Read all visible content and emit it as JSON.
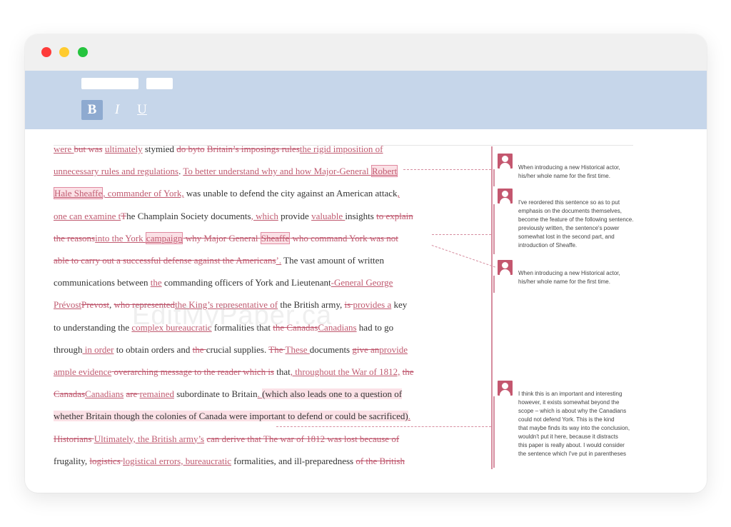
{
  "window": {
    "controls": [
      "close",
      "minimize",
      "maximize"
    ]
  },
  "toolbar": {
    "bold": "B",
    "italic": "I",
    "underline": "U"
  },
  "watermark": "EditMyPaper.ca",
  "document": {
    "lines": [
      [
        {
          "t": "were ",
          "s": "ins"
        },
        {
          "t": "but was",
          "s": "del"
        },
        {
          "t": " "
        },
        {
          "t": "ultimately",
          "s": "ins"
        },
        {
          "t": " stymied "
        },
        {
          "t": "do by",
          "s": "del"
        },
        {
          "t": "to",
          "s": "del"
        },
        {
          "t": " "
        },
        {
          "t": "Britain’s imposings rules",
          "s": "del"
        },
        {
          "t": "the rigid imposition of",
          "s": "ins"
        }
      ],
      [
        {
          "t": "unnecessary rules and regulations",
          "s": "ins"
        },
        {
          "t": ".  "
        },
        {
          "t": "To better understand why and how Major-General ",
          "s": "ins"
        },
        {
          "t": "Robert",
          "s": "ins hl box"
        }
      ],
      [
        {
          "t": "Hale Sheaffe",
          "s": "ins hl box"
        },
        {
          "t": ", commander of York,",
          "s": "ins"
        },
        {
          "t": " was unable to defend the city against an American attack"
        },
        {
          "t": ",",
          "s": "ins"
        }
      ],
      [
        {
          "t": "one can examine t",
          "s": "ins"
        },
        {
          "t": "T",
          "s": "del"
        },
        {
          "t": "he Champlain Society documents"
        },
        {
          "t": ", which",
          "s": "ins"
        },
        {
          "t": " provide "
        },
        {
          "t": "valuable ",
          "s": "ins"
        },
        {
          "t": "insights "
        },
        {
          "t": "to explain",
          "s": "del"
        }
      ],
      [
        {
          "t": "the reasons",
          "s": "del"
        },
        {
          "t": "into the York ",
          "s": "ins"
        },
        {
          "t": "campaign",
          "s": "ins hl box"
        },
        {
          "t": " why Major General ",
          "s": "del"
        },
        {
          "t": "Sheaffe",
          "s": "del hl box"
        },
        {
          "t": " who command York was not",
          "s": "del"
        }
      ],
      [
        {
          "t": "able to carry out a successful defense against the Americans",
          "s": "del"
        },
        {
          "t": "’.",
          "s": "ins"
        },
        {
          "t": "  The vast amount of written"
        }
      ],
      [
        {
          "t": "communications between "
        },
        {
          "t": "the",
          "s": "ins"
        },
        {
          "t": " commanding officers of York and Lieutenant"
        },
        {
          "t": "-General George",
          "s": "ins"
        }
      ],
      [
        {
          "t": "Prévost",
          "s": "ins"
        },
        {
          "t": "Prevost",
          "s": "del"
        },
        {
          "t": ", "
        },
        {
          "t": "who represented",
          "s": "del"
        },
        {
          "t": "the King’s representative of",
          "s": "ins"
        },
        {
          "t": " the British army, "
        },
        {
          "t": "is ",
          "s": "del"
        },
        {
          "t": "provides a",
          "s": "ins"
        },
        {
          "t": " key"
        }
      ],
      [
        {
          "t": "to understanding the "
        },
        {
          "t": "complex bureaucratic",
          "s": "ins"
        },
        {
          "t": " formalities that "
        },
        {
          "t": "the Canadas",
          "s": "del"
        },
        {
          "t": "Canadians",
          "s": "ins"
        },
        {
          "t": " had to go"
        }
      ],
      [
        {
          "t": "through"
        },
        {
          "t": " in order",
          "s": "ins"
        },
        {
          "t": " to obtain orders and "
        },
        {
          "t": "the ",
          "s": "del"
        },
        {
          "t": "crucial supplies.  "
        },
        {
          "t": "The ",
          "s": "del"
        },
        {
          "t": "These ",
          "s": "ins"
        },
        {
          "t": "documents "
        },
        {
          "t": "give an",
          "s": "del"
        },
        {
          "t": "provide",
          "s": "ins"
        }
      ],
      [
        {
          "t": "ample evidence",
          "s": "ins"
        },
        {
          "t": " overarching message to the reader which is",
          "s": "del"
        },
        {
          "t": " that"
        },
        {
          "t": ", throughout the War of 1812,",
          "s": "ins"
        },
        {
          "t": " "
        },
        {
          "t": "the",
          "s": "del"
        }
      ],
      [
        {
          "t": "Canadas",
          "s": "del"
        },
        {
          "t": "Canadians",
          "s": "ins"
        },
        {
          "t": " "
        },
        {
          "t": "are ",
          "s": "del"
        },
        {
          "t": "remained",
          "s": "ins"
        },
        {
          "t": " subordinate to Britain"
        },
        {
          "t": ". ",
          "s": "ins"
        },
        {
          "t": " ",
          "s": "del"
        },
        {
          "t": "(which also leads one to a question of",
          "s": "hl"
        }
      ],
      [
        {
          "t": "whether Britain though the colonies of Canada were important to defend or could be sacrificed)",
          "s": "hl"
        },
        {
          "t": ".",
          "s": "ins"
        }
      ],
      [
        {
          "t": "Historians ",
          "s": "del"
        },
        {
          "t": "Ultimately, the British army’s",
          "s": "ins"
        },
        {
          "t": " "
        },
        {
          "t": "can derive that The war of 1812 was lost because of",
          "s": "del"
        }
      ],
      [
        {
          "t": "frugality, "
        },
        {
          "t": "logistics ",
          "s": "del"
        },
        {
          "t": "logistical errors, bureaucratic",
          "s": "ins"
        },
        {
          "t": " formalities, and ill-preparedness "
        },
        {
          "t": "of the British",
          "s": "del"
        }
      ]
    ]
  },
  "comments": [
    {
      "lines": [
        "When introducing a new Historical actor,",
        "his/her whole name for the first time."
      ]
    },
    {
      "lines": [
        "I've reordered this sentence so as to put",
        "emphasis on the documents themselves,",
        "become the feature of the following sentence.",
        "previously written, the sentence's power",
        "somewhat lost in the second part, and",
        "introduction of Sheaffe."
      ]
    },
    {
      "lines": [
        "When introducing a new Historical actor,",
        "his/her whole name for the first time."
      ]
    },
    {
      "lines": [
        "I think this is an important and interesting",
        "however, it exists somewhat beyond the",
        "scope – which is about why the Canadians",
        "could not defend York.  This is the kind",
        "that maybe finds its way into the conclusion,",
        "wouldn't put it here, because it distracts",
        "this paper is really about.  I would consider",
        "the sentence which I've put in parentheses"
      ]
    }
  ]
}
